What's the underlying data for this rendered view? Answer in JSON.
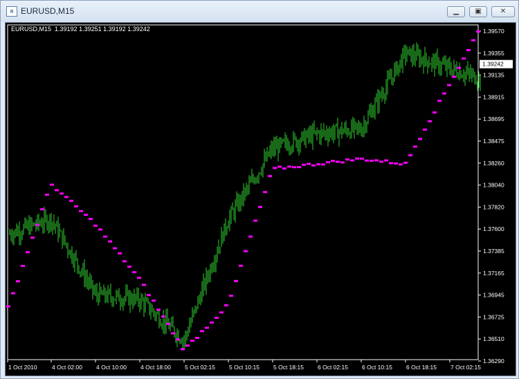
{
  "window": {
    "title": "EURUSD,M15",
    "icon": "chart-window-icon",
    "controls": {
      "minimize": "minimize-icon",
      "maximize": "maximize-icon",
      "close": "close-icon"
    }
  },
  "chart_header": {
    "symbol": "EURUSD,M15",
    "open": "1.39192",
    "high": "1.39251",
    "low": "1.39192",
    "close": "1.39242"
  },
  "colors": {
    "background": "#000000",
    "candles": "#2fd22f",
    "sar": "#ff00ff",
    "price_label_bg": "#ffffff"
  },
  "chart_data": {
    "type": "line",
    "y_ticks": [
      "1.39570",
      "1.39355",
      "1.39135",
      "1.38915",
      "1.38695",
      "1.38475",
      "1.38260",
      "1.38040",
      "1.37820",
      "1.37600",
      "1.37385",
      "1.37165",
      "1.36945",
      "1.36725",
      "1.36510",
      "1.36290"
    ],
    "x_ticks": [
      "1 Oct 2010",
      "4 Oct 02:00",
      "4 Oct 10:00",
      "4 Oct 18:00",
      "5 Oct 02:15",
      "5 Oct 10:15",
      "5 Oct 18:15",
      "6 Oct 02:15",
      "6 Oct 10:15",
      "6 Oct 18:15",
      "7 Oct 02:15"
    ],
    "ylim": [
      1.3629,
      1.3957
    ],
    "current_price": "1.39242",
    "series": [
      {
        "x": [
          "1 Oct 2010",
          "4 Oct 02:00",
          "4 Oct 10:00",
          "4 Oct 18:00",
          "5 Oct 02:15",
          "5 Oct 10:15",
          "5 Oct 18:15",
          "6 Oct 02:15",
          "6 Oct 10:15",
          "6 Oct 18:15",
          "7 Oct 02:15"
        ],
        "values": [
          1.3755,
          1.377,
          1.3695,
          1.369,
          1.365,
          1.377,
          1.384,
          1.3855,
          1.386,
          1.3935,
          1.392
        ]
      },
      {
        "x": [
          "1 Oct 2010",
          "4 Oct 02:00",
          "4 Oct 10:00",
          "4 Oct 18:00",
          "5 Oct 02:15",
          "5 Oct 10:15",
          "5 Oct 18:15",
          "6 Oct 02:15",
          "6 Oct 10:15",
          "6 Oct 18:15",
          "7 Oct 02:15"
        ],
        "values": [
          1.368,
          1.3805,
          1.3765,
          1.371,
          1.364,
          1.3685,
          1.382,
          1.3825,
          1.383,
          1.3825,
          1.3905
        ]
      }
    ]
  }
}
